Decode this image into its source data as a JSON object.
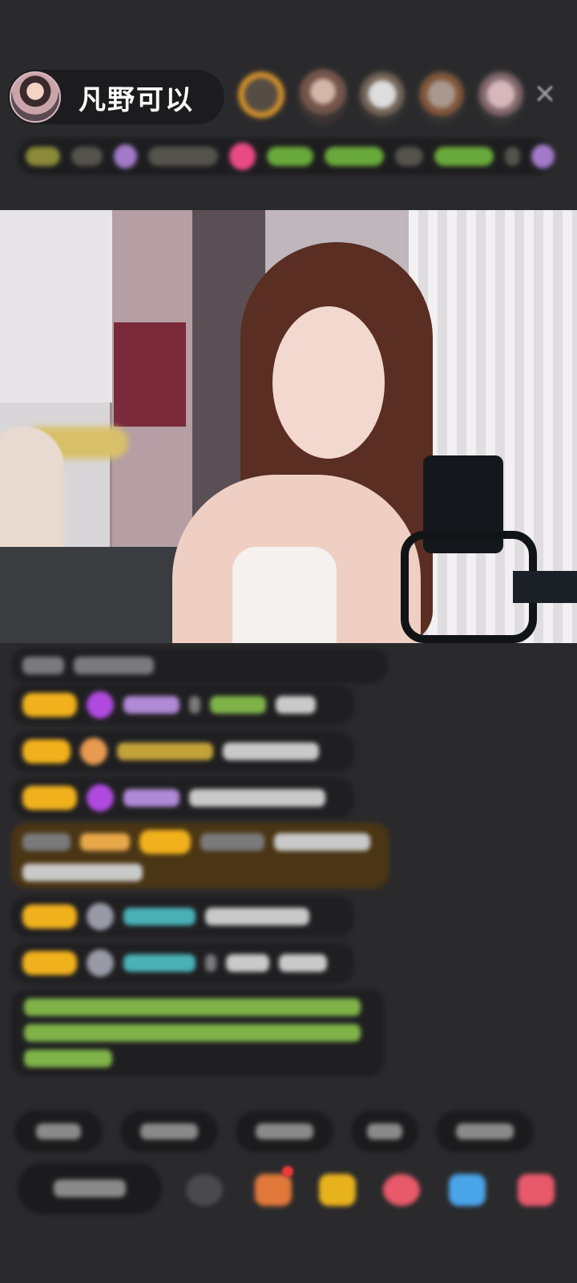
{
  "host": {
    "name": "凡野可以",
    "avatar_icon": "host-avatar"
  },
  "viewers": {
    "count_shown": 5
  },
  "colors": {
    "background": "#2a2a2c",
    "pill": "#1c1c1e",
    "badge_gold": "#f1b11c",
    "special_message_bg": "#4a3514",
    "notice_text_green": "#7fb248"
  },
  "icons": {
    "close": "close-icon",
    "emoji": "emoji-icon",
    "gifts": [
      "gift-box-icon",
      "treasure-chest-icon",
      "red-envelope-icon",
      "game-icon",
      "gift-icon"
    ]
  }
}
